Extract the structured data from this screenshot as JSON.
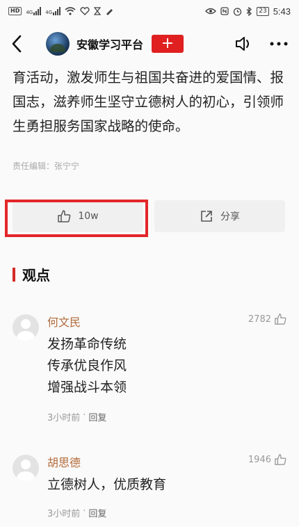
{
  "status_bar": {
    "left_badges": [
      "HD",
      "4G",
      "4G"
    ],
    "battery": "23",
    "time": "5:43"
  },
  "header": {
    "channel_name": "安徽学习平台",
    "follow_label": "+"
  },
  "article": {
    "paragraph": "育活动，激发师生与祖国共奋进的爱国情、报国志，滋养师生坚守立德树人的初心，引领师生勇担服务国家战略的使命。",
    "editor": "责任编辑：张宁宁"
  },
  "actions": {
    "like_count": "10w",
    "share_label": "分享"
  },
  "comments_section": {
    "title": "观点",
    "comments": [
      {
        "name": "何文民",
        "likes": "2782",
        "lines": [
          "发扬革命传统",
          "传承优良作风",
          "增强战斗本领"
        ],
        "time": "3小时前",
        "sep": "·",
        "reply": "回复"
      },
      {
        "name": "胡思德",
        "likes": "1946",
        "lines": [
          "立德树人，优质教育"
        ],
        "time": "3小时前",
        "sep": "·",
        "reply": "回复"
      }
    ]
  },
  "colors": {
    "accent_red": "#e02020",
    "name_color": "#b36b3a"
  }
}
